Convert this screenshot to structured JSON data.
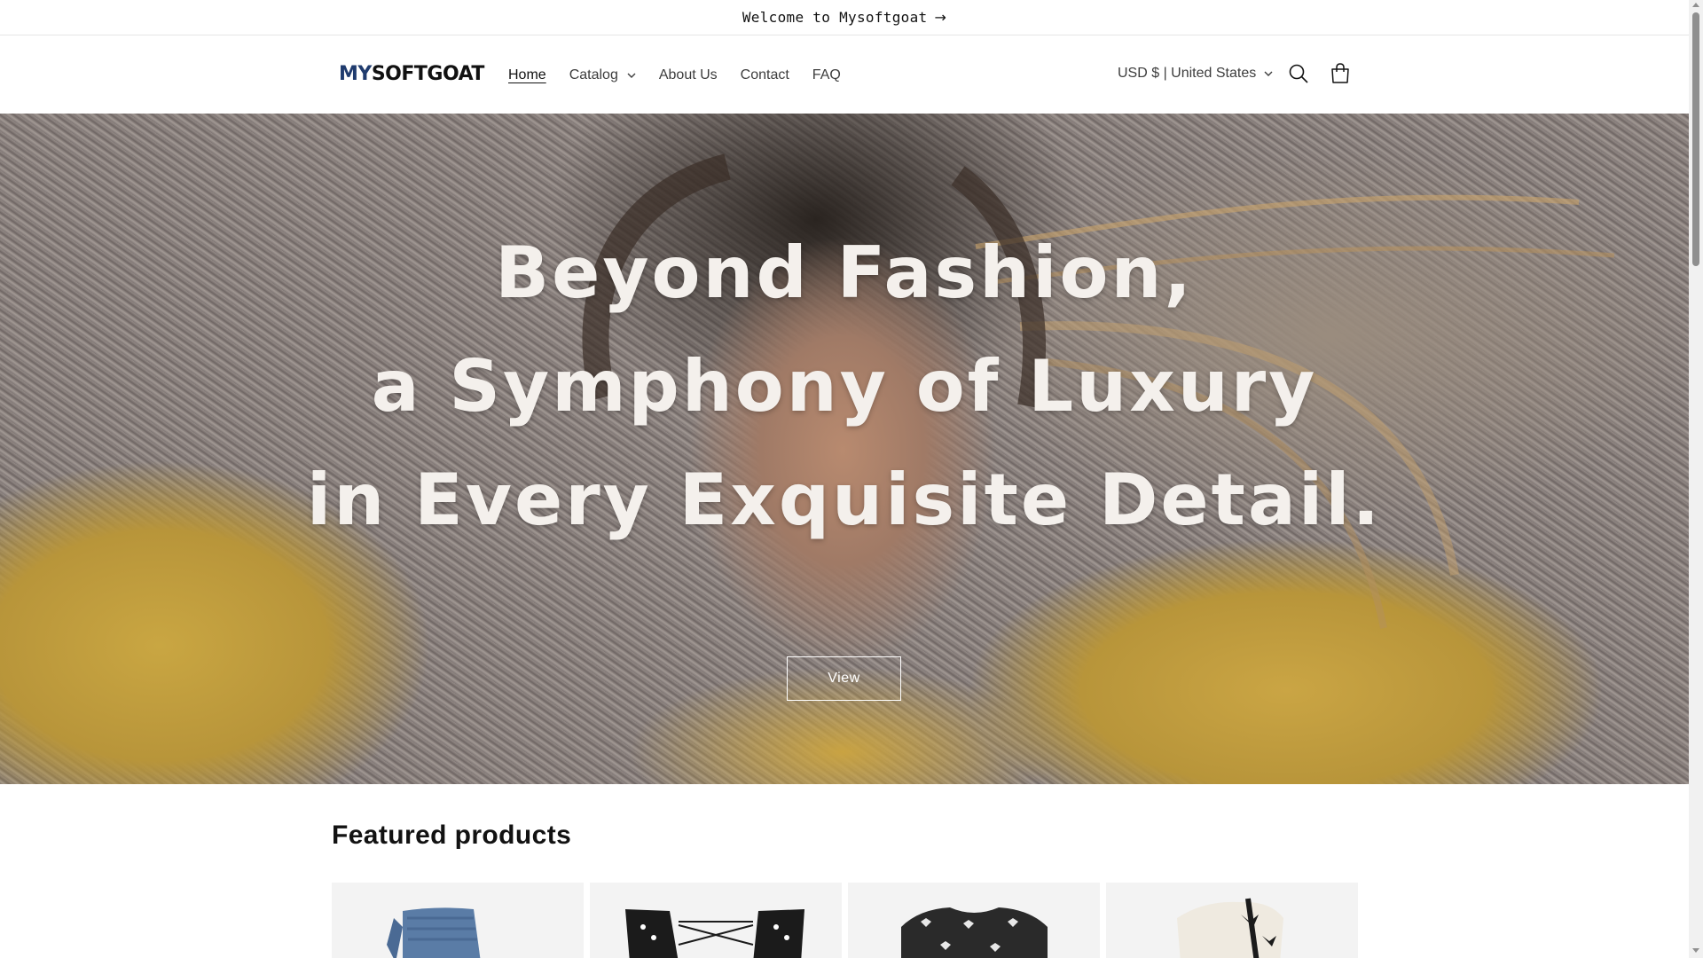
{
  "announcement": {
    "text": "Welcome to Mysoftgoat",
    "arrow": "→"
  },
  "header": {
    "logo": {
      "part1": "MY",
      "part2": "SOFTGOAT"
    },
    "nav": [
      {
        "label": "Home",
        "active": true
      },
      {
        "label": "Catalog",
        "has_dropdown": true
      },
      {
        "label": "About Us"
      },
      {
        "label": "Contact"
      },
      {
        "label": "FAQ"
      }
    ],
    "currency": "USD $ | United States",
    "icons": [
      "search-icon",
      "cart-icon"
    ]
  },
  "hero": {
    "headline_lines": [
      "Beyond Fashion,",
      "a Symphony of Luxury",
      "in Every Exquisite Detail."
    ],
    "button_label": "View"
  },
  "featured": {
    "title": "Featured products",
    "products": [
      {
        "image": "blue knit sweater"
      },
      {
        "image": "black and white patterned lace-up top"
      },
      {
        "image": "black heart pattern sweater"
      },
      {
        "image": "cream fuzzy cardigan with black bow trim"
      }
    ]
  },
  "colors": {
    "logo_accent": "#1f3b6e",
    "text": "#121212",
    "hero_text": "#f4f0ec"
  }
}
